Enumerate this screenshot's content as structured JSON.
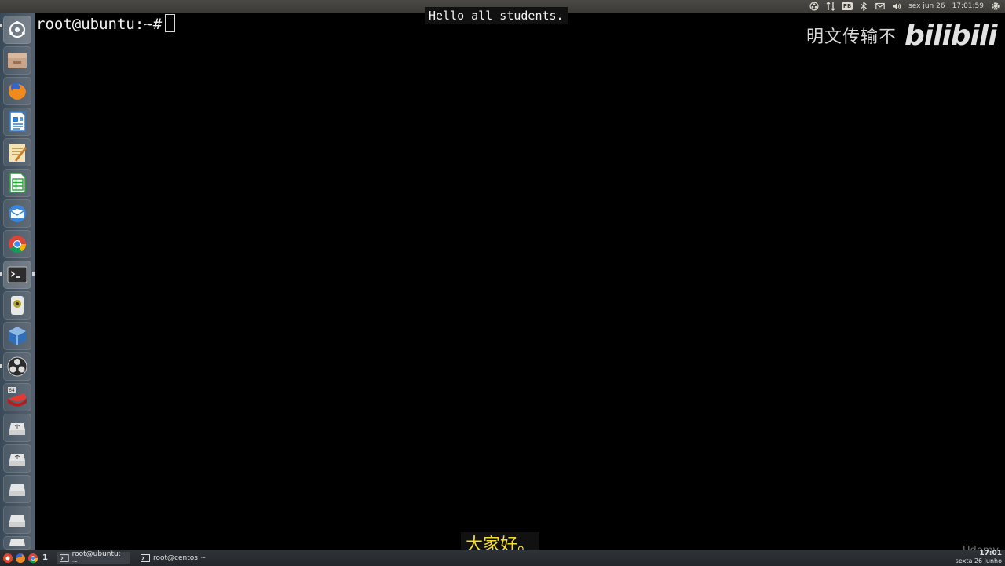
{
  "top_panel": {
    "date": "sex jun 26",
    "time": "17:01:59",
    "tray_icons": [
      "obs-icon",
      "network-arrows-icon",
      "pb-icon",
      "bluetooth-icon",
      "mail-icon",
      "volume-icon",
      "gear-icon"
    ],
    "pb_label": "PB"
  },
  "launcher": {
    "items": [
      {
        "name": "dash-home-icon"
      },
      {
        "name": "file-manager-icon"
      },
      {
        "name": "firefox-icon"
      },
      {
        "name": "writer-icon"
      },
      {
        "name": "text-editor-icon"
      },
      {
        "name": "calc-icon"
      },
      {
        "name": "mail-client-icon"
      },
      {
        "name": "chrome-icon"
      },
      {
        "name": "terminal-icon"
      },
      {
        "name": "disk-usage-icon"
      },
      {
        "name": "virtualbox-icon"
      },
      {
        "name": "obs-icon"
      },
      {
        "name": "ruby-64-icon"
      },
      {
        "name": "usb-drive-icon"
      },
      {
        "name": "usb-drive-icon"
      },
      {
        "name": "drive-icon"
      },
      {
        "name": "drive-icon"
      }
    ],
    "ruby_badge": "64"
  },
  "terminal": {
    "prompt": "root@ubuntu:~#"
  },
  "captions": {
    "english": "Hello all students.",
    "chinese": "大家好。"
  },
  "watermark": {
    "text": "明文传输不",
    "logo": "bilibili"
  },
  "udemy_label": "Udemy",
  "bottom_panel": {
    "workspace": "1",
    "tasks": [
      {
        "label": "root@ubuntu: ~"
      },
      {
        "label": "root@centos:~"
      }
    ],
    "clock_time": "17:01",
    "clock_date": "sexta 26 junho"
  },
  "colors": {
    "terminal_bg": "#000000",
    "terminal_fg": "#f2f2f2",
    "caption_cn": "#f5dd2c",
    "launcher_bg": "#4c5966",
    "panel_bg": "#3b3a36"
  }
}
